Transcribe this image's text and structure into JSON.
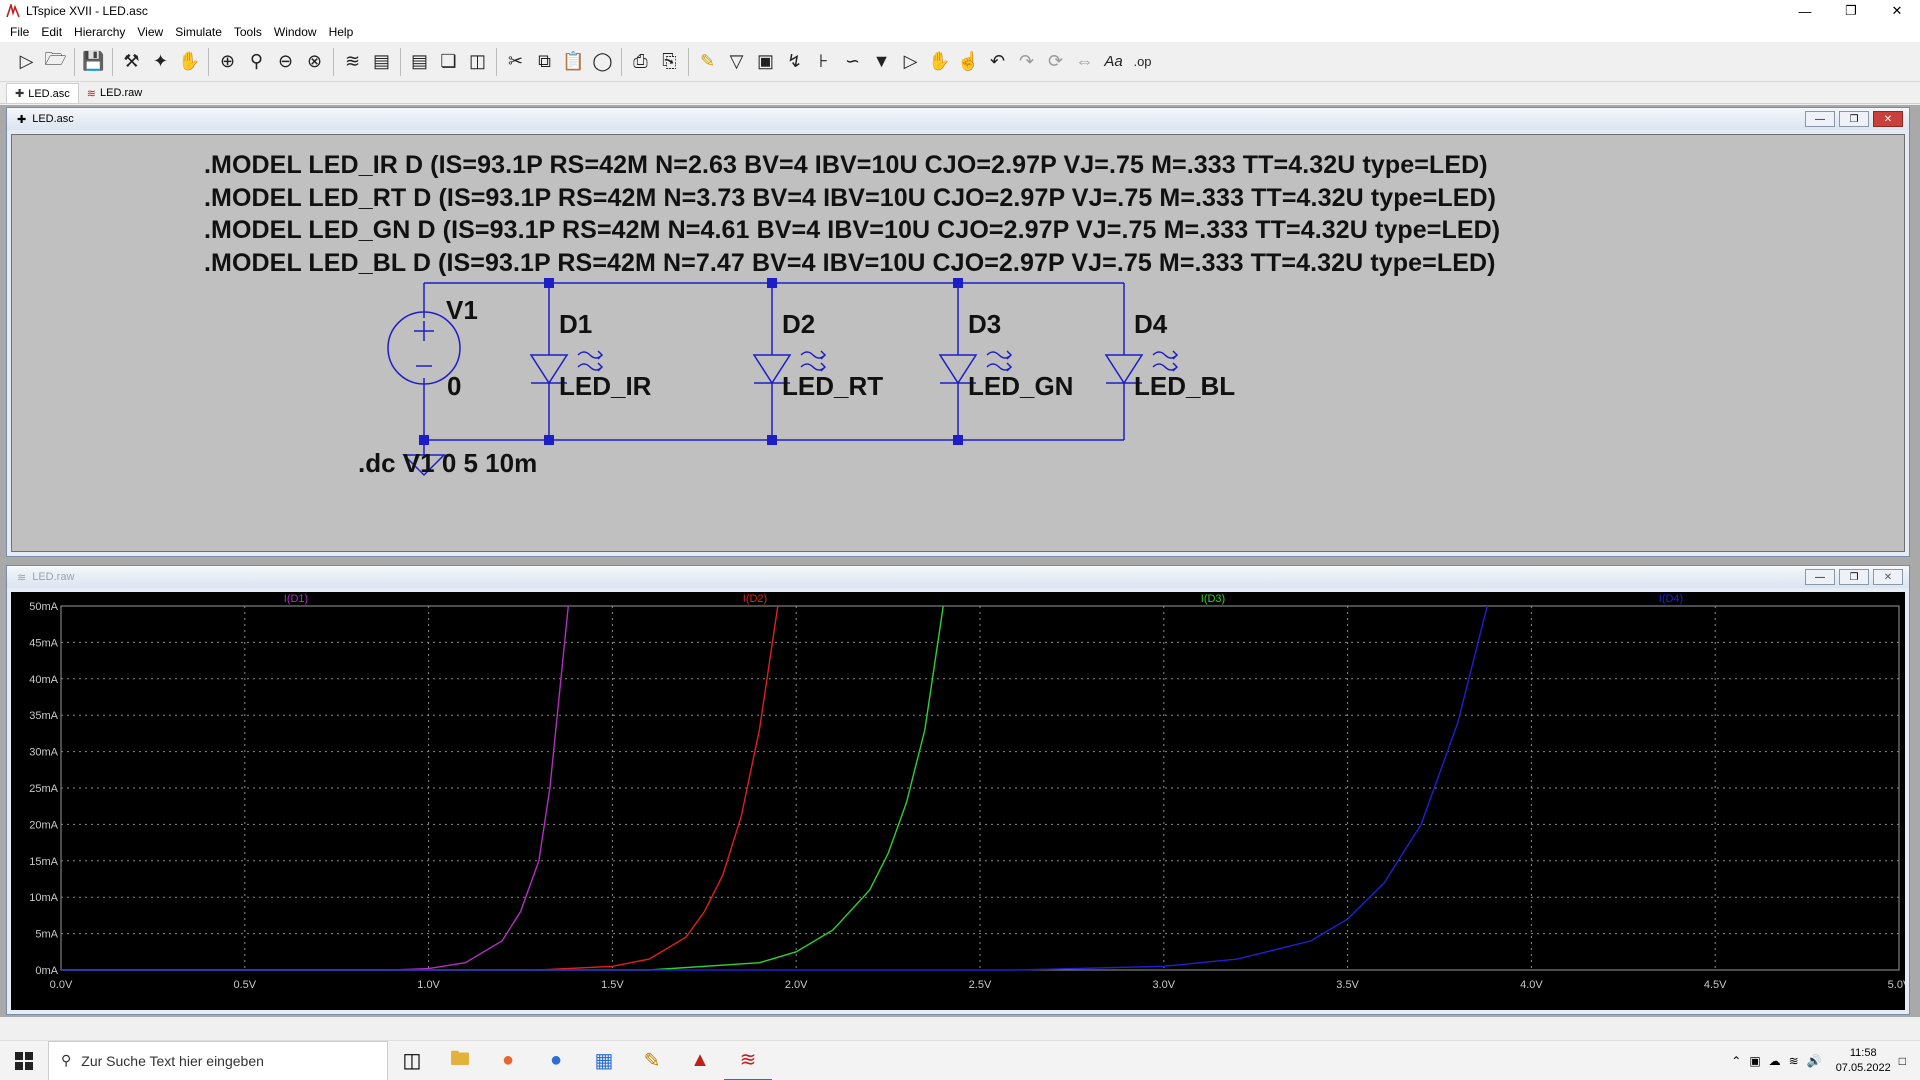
{
  "window": {
    "title": "LTspice XVII - LED.asc"
  },
  "menu": [
    "File",
    "Edit",
    "Hierarchy",
    "View",
    "Simulate",
    "Tools",
    "Window",
    "Help"
  ],
  "toolbar_icons": [
    "run-icon",
    "open-icon",
    "save-icon",
    "hammer-icon",
    "pick-icon",
    "pan-icon",
    "zoom-in-icon",
    "zoom-icon",
    "zoom-out-icon",
    "zoom-cancel-icon",
    "autorange-icon",
    "plot-pane-icon",
    "tile-horizontal-icon",
    "cascade-icon",
    "tile-vertical-icon",
    "cut-icon",
    "copy-icon",
    "paste-icon",
    "find-icon",
    "print-icon",
    "print-preview-icon",
    "pencil-icon",
    "ground-icon",
    "label-icon",
    "resistor-icon",
    "capacitor-icon",
    "inductor-icon",
    "diode-icon",
    "component-icon",
    "move-icon",
    "drag-icon",
    "undo-icon",
    "redo-icon",
    "rotate-icon",
    "mirror-icon",
    "text-icon",
    "spice-directive-icon"
  ],
  "tabs": [
    {
      "label": "LED.asc",
      "icon": "schematic-icon",
      "active": true
    },
    {
      "label": "LED.raw",
      "icon": "waveform-icon",
      "active": false
    }
  ],
  "schematic": {
    "title": "LED.asc",
    "models": [
      ".MODEL LED_IR D (IS=93.1P RS=42M N=2.63 BV=4 IBV=10U CJO=2.97P VJ=.75 M=.333 TT=4.32U type=LED)",
      ".MODEL LED_RT D (IS=93.1P RS=42M N=3.73 BV=4 IBV=10U CJO=2.97P VJ=.75 M=.333 TT=4.32U type=LED)",
      ".MODEL LED_GN D (IS=93.1P RS=42M N=4.61 BV=4 IBV=10U CJO=2.97P VJ=.75 M=.333 TT=4.32U type=LED)",
      ".MODEL LED_BL D (IS=93.1P RS=42M N=7.47 BV=4 IBV=10U CJO=2.97P VJ=.75 M=.333 TT=4.32U type=LED)"
    ],
    "source": {
      "name": "V1",
      "value": "0"
    },
    "diodes": [
      {
        "name": "D1",
        "model": "LED_IR"
      },
      {
        "name": "D2",
        "model": "LED_RT"
      },
      {
        "name": "D3",
        "model": "LED_GN"
      },
      {
        "name": "D4",
        "model": "LED_BL"
      }
    ],
    "directive": ".dc V1 0 5 10m",
    "wire_color": "#1e1ec8"
  },
  "plot_window": {
    "title": "LED.raw"
  },
  "chart_data": {
    "type": "line",
    "xlabel": "",
    "ylabel": "",
    "xlim": [
      0,
      5
    ],
    "ylim": [
      0,
      50
    ],
    "x_unit": "V",
    "y_unit": "mA",
    "grid": true,
    "legend": "top",
    "x_ticks": [
      "0.0V",
      "0.5V",
      "1.0V",
      "1.5V",
      "2.0V",
      "2.5V",
      "3.0V",
      "3.5V",
      "4.0V",
      "4.5V",
      "5.0V"
    ],
    "y_ticks": [
      "0mA",
      "5mA",
      "10mA",
      "15mA",
      "20mA",
      "25mA",
      "30mA",
      "35mA",
      "40mA",
      "45mA",
      "50mA"
    ],
    "series": [
      {
        "name": "I(D1)",
        "color": "#b030c0",
        "x": [
          0.9,
          1.0,
          1.1,
          1.2,
          1.25,
          1.3,
          1.33,
          1.36,
          1.38
        ],
        "y": [
          0,
          0.2,
          1,
          4,
          8,
          15,
          25,
          40,
          50
        ]
      },
      {
        "name": "I(D2)",
        "color": "#e02020",
        "x": [
          1.3,
          1.5,
          1.6,
          1.7,
          1.75,
          1.8,
          1.85,
          1.9,
          1.95
        ],
        "y": [
          0,
          0.5,
          1.5,
          4.5,
          8,
          13,
          21,
          33,
          50
        ]
      },
      {
        "name": "I(D3)",
        "color": "#30d030",
        "x": [
          1.6,
          1.9,
          2.0,
          2.1,
          2.2,
          2.25,
          2.3,
          2.35,
          2.4
        ],
        "y": [
          0,
          1,
          2.5,
          5.5,
          11,
          16,
          23,
          33,
          50
        ]
      },
      {
        "name": "I(D4)",
        "color": "#2020d0",
        "x": [
          2.6,
          3.0,
          3.2,
          3.4,
          3.5,
          3.6,
          3.7,
          3.8,
          3.88
        ],
        "y": [
          0,
          0.5,
          1.5,
          4,
          7,
          12,
          20,
          34,
          50
        ]
      }
    ]
  },
  "taskbar": {
    "search_placeholder": "Zur Suche Text hier eingeben",
    "time": "11:58",
    "date": "07.05.2022"
  }
}
